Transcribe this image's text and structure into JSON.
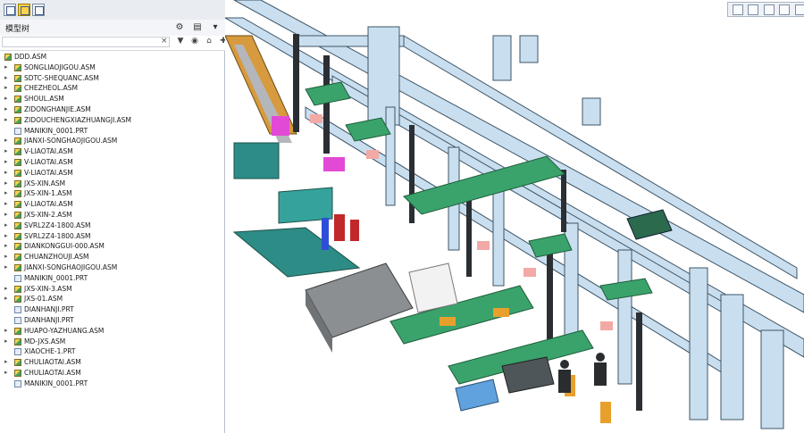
{
  "panel": {
    "title": "模型树",
    "filter_value": "",
    "clear_label": "×",
    "tools": [
      "▼",
      "◉",
      "⌂",
      "✚"
    ]
  },
  "tree": {
    "root": "DDD.ASM",
    "items": [
      {
        "label": "SONGLIAOJIGOU.ASM",
        "kind": "asm"
      },
      {
        "label": "SDTC-SHEQUANC.ASM",
        "kind": "asm"
      },
      {
        "label": "CHEZHEOL.ASM",
        "kind": "asm"
      },
      {
        "label": "SHOUL.ASM",
        "kind": "asm"
      },
      {
        "label": "ZIDONGHANJIE.ASM",
        "kind": "asm"
      },
      {
        "label": "ZIDOUCHENGXIAZHUANGJI.ASM",
        "kind": "asm"
      },
      {
        "label": "MANIKIN_0001.PRT",
        "kind": "prt"
      },
      {
        "label": "JIANXI-SONGHAOJIGOU.ASM",
        "kind": "asm"
      },
      {
        "label": "V-LIAOTAI.ASM",
        "kind": "asm"
      },
      {
        "label": "V-LIAOTAI.ASM",
        "kind": "asm"
      },
      {
        "label": "V-LIAOTAI.ASM",
        "kind": "asm"
      },
      {
        "label": "JXS-XIN.ASM",
        "kind": "asm"
      },
      {
        "label": "JXS-XIN-1.ASM",
        "kind": "asm"
      },
      {
        "label": "V-LIAOTAI.ASM",
        "kind": "asm"
      },
      {
        "label": "JXS-XIN-2.ASM",
        "kind": "asm"
      },
      {
        "label": "SVRL2Z4-1800.ASM",
        "kind": "asm"
      },
      {
        "label": "SVRL2Z4-1800.ASM",
        "kind": "asm"
      },
      {
        "label": "DIANKONGGUI-000.ASM",
        "kind": "asm"
      },
      {
        "label": "CHUANZHOUJI.ASM",
        "kind": "asm"
      },
      {
        "label": "JIANXI-SONGHAOJIGOU.ASM",
        "kind": "asm"
      },
      {
        "label": "MANIKIN_0001.PRT",
        "kind": "prt"
      },
      {
        "label": "JXS-XIN-3.ASM",
        "kind": "asm"
      },
      {
        "label": "JXS-01.ASM",
        "kind": "asm"
      },
      {
        "label": "DIANHANJI.PRT",
        "kind": "prt"
      },
      {
        "label": "DIANHANJI.PRT",
        "kind": "prt"
      },
      {
        "label": "HUAPO-YAZHUANG.ASM",
        "kind": "asm"
      },
      {
        "label": "MD-JXS.ASM",
        "kind": "asm"
      },
      {
        "label": "XIAOCHE-1.PRT",
        "kind": "prt"
      },
      {
        "label": "CHULIAOTAI.ASM",
        "kind": "asm"
      },
      {
        "label": "CHULIAOTAI.ASM",
        "kind": "asm"
      },
      {
        "label": "MANIKIN_0001.PRT",
        "kind": "prt"
      }
    ]
  },
  "colors": {
    "frame": "#b6d3ea",
    "frame_edge": "#4a5e6e",
    "teal": "#2d8c85",
    "green_plate": "#3aa36b",
    "magenta": "#e24ad6",
    "orange": "#e8a02c",
    "gray_machine": "#8b8f92",
    "blue_bin": "#5fa2de"
  },
  "toolbar": {
    "buttons": [
      "zoom-window",
      "zoom-in",
      "zoom-out",
      "refit",
      "repaint",
      "named-views",
      "spin-center",
      "datum-display",
      "saved-orientation"
    ]
  }
}
